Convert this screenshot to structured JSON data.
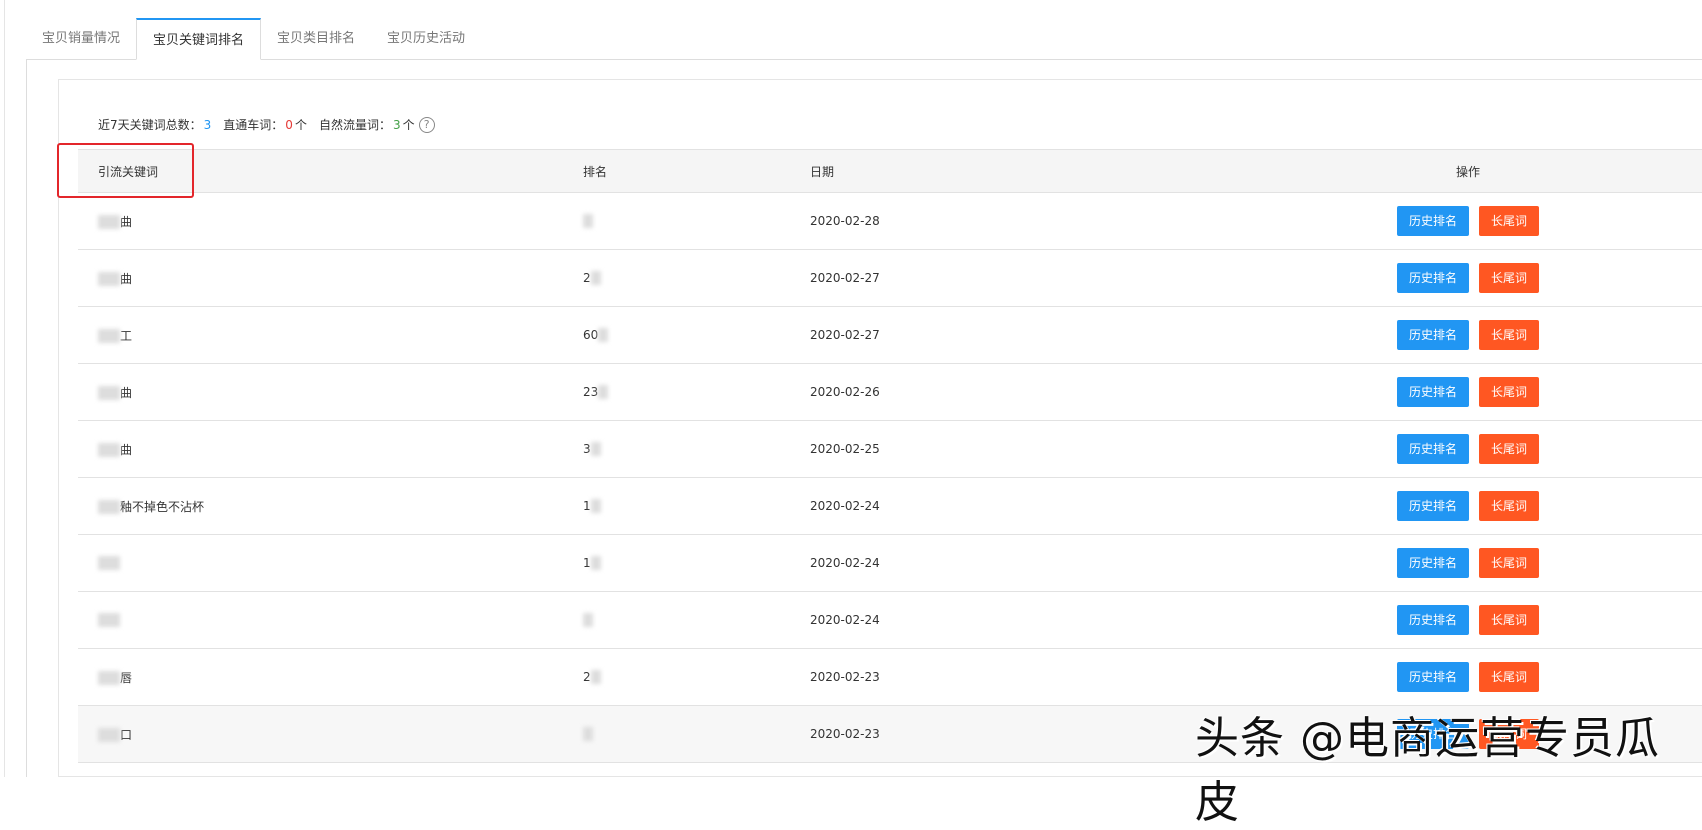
{
  "tabs": [
    "宝贝销量情况",
    "宝贝关键词排名",
    "宝贝类目排名",
    "宝贝历史活动"
  ],
  "summary": {
    "total_label": "近7天关键词总数：",
    "total": "3",
    "ztc_label": "直通车词：",
    "ztc": "0",
    "ztc_unit": "个",
    "natural_label": "自然流量词：",
    "natural": "3",
    "natural_unit": "个",
    "help": "?"
  },
  "table": {
    "headers": [
      "引流关键词",
      "排名",
      "日期",
      "操作"
    ],
    "rows": [
      {
        "keyword": "曲",
        "rank": "",
        "date": "2020-02-28"
      },
      {
        "keyword": "曲",
        "rank": "2",
        "date": "2020-02-27"
      },
      {
        "keyword": "工",
        "rank": "60",
        "date": "2020-02-27"
      },
      {
        "keyword": "曲",
        "rank": "23",
        "date": "2020-02-26"
      },
      {
        "keyword": "曲",
        "rank": "3",
        "date": "2020-02-25"
      },
      {
        "keyword": "釉不掉色不沾杯",
        "rank": "1",
        "date": "2020-02-24"
      },
      {
        "keyword": "",
        "rank": "1",
        "date": "2020-02-24"
      },
      {
        "keyword": "",
        "rank": "",
        "date": "2020-02-24"
      },
      {
        "keyword": "唇",
        "rank": "2",
        "date": "2020-02-23"
      },
      {
        "keyword": "口",
        "rank": "",
        "date": "2020-02-23"
      }
    ],
    "history_btn": "历史排名",
    "longtail_btn": "长尾词"
  },
  "watermark": "头条 @电商运营专员瓜皮"
}
